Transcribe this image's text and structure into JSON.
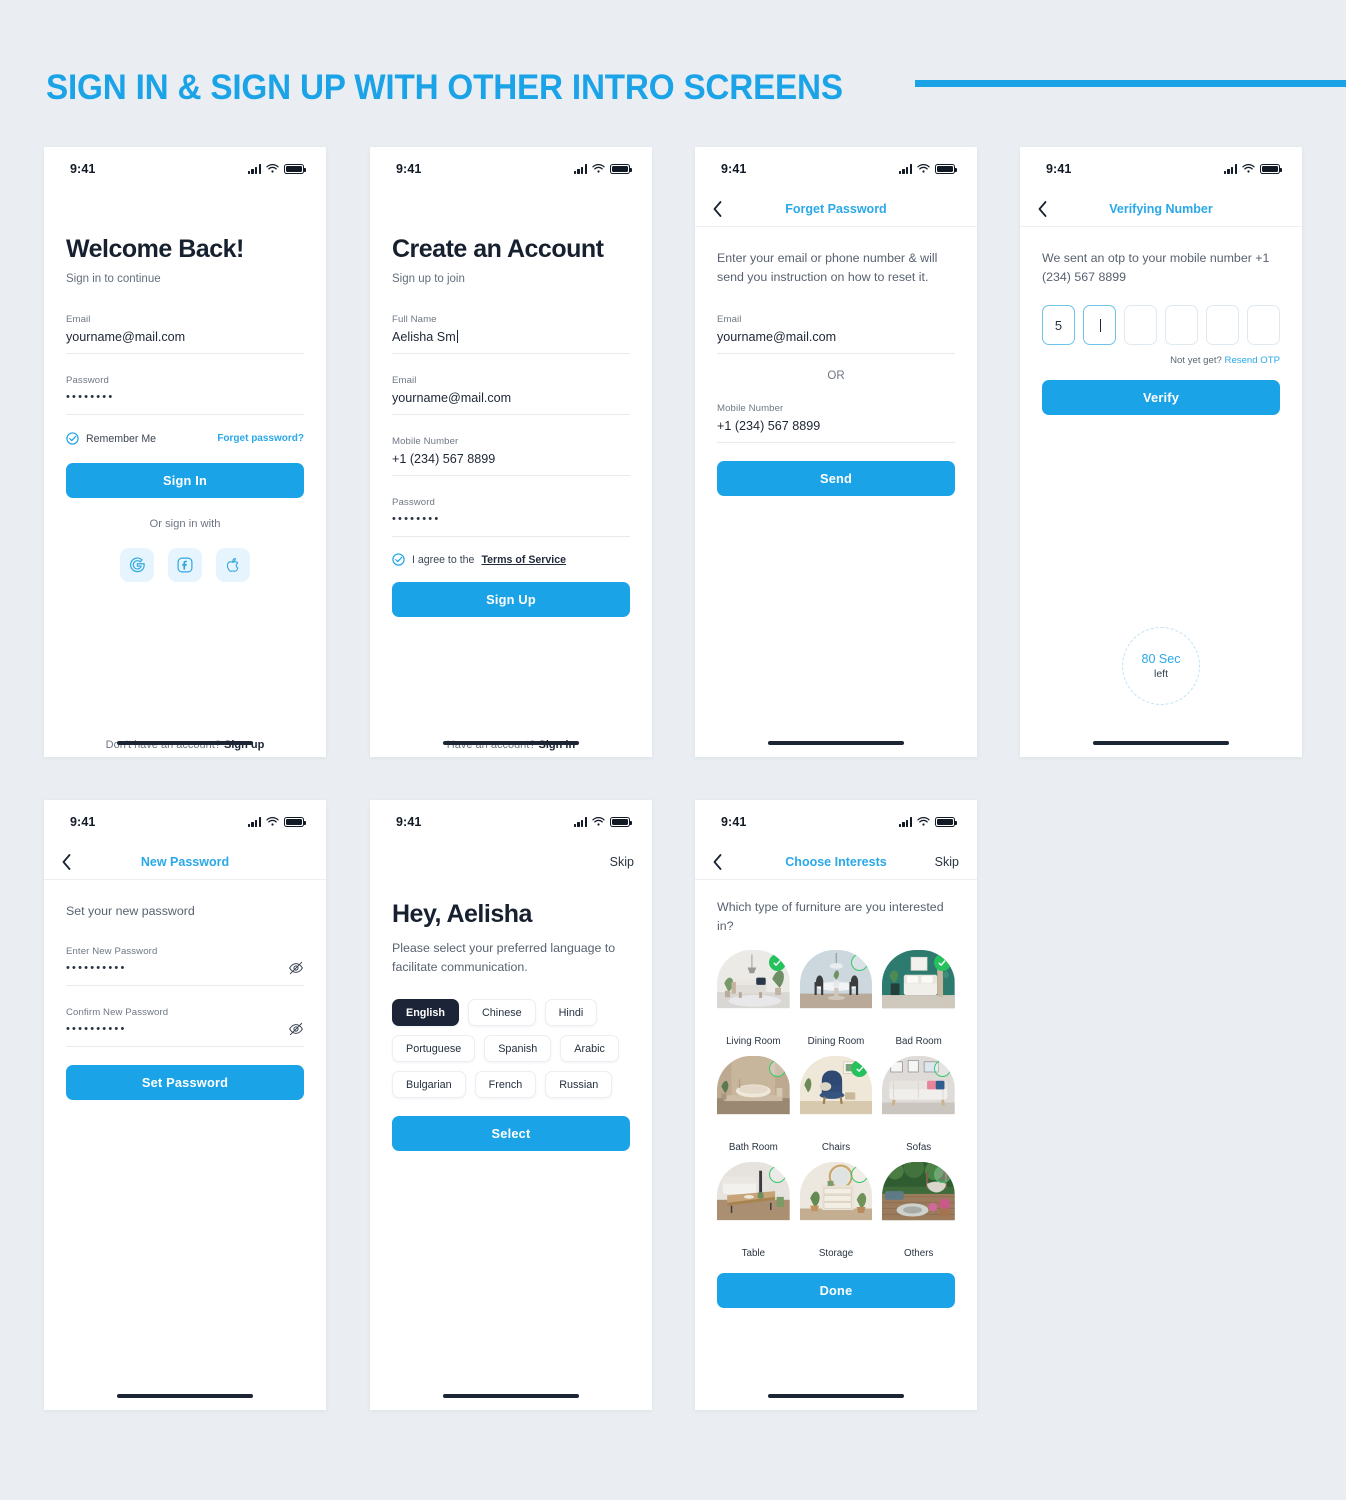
{
  "header": {
    "title": "SIGN IN & SIGN UP WITH OTHER INTRO SCREENS",
    "accent_color": "#1ba3e8"
  },
  "status_bar": {
    "time": "9:41"
  },
  "colors": {
    "primary": "#1ba3e8",
    "dark": "#1b2537",
    "green": "#25c15c",
    "page_bg": "#eaeef2"
  },
  "screens": {
    "sign_in": {
      "title": "Welcome Back!",
      "subtitle": "Sign in to continue",
      "email": {
        "label": "Email",
        "value": "yourname@mail.com"
      },
      "password": {
        "label": "Password",
        "value": "••••••••"
      },
      "remember_label": "Remember Me",
      "forget_link": "Forget password?",
      "primary_button": "Sign In",
      "or_text": "Or sign in with",
      "socials": [
        "google-icon",
        "facebook-icon",
        "apple-icon"
      ],
      "footer_text": "Don't have an account?",
      "footer_link": "Sign up"
    },
    "sign_up": {
      "title": "Create an Account",
      "subtitle": "Sign up to join",
      "full_name": {
        "label": "Full Name",
        "value": "Aelisha Sm"
      },
      "email": {
        "label": "Email",
        "value": "yourname@mail.com"
      },
      "mobile": {
        "label": "Mobile Number",
        "value": "+1 (234) 567 8899"
      },
      "password": {
        "label": "Password",
        "value": "••••••••"
      },
      "terms_prefix": "I agree to the",
      "terms_link": "Terms of Service",
      "primary_button": "Sign Up",
      "footer_text": "Have an account?",
      "footer_link": "Sign in"
    },
    "forget_password": {
      "nav_title": "Forget Password",
      "description": "Enter your email or phone number & will send you instruction on how to reset it.",
      "email": {
        "label": "Email",
        "value": "yourname@mail.com"
      },
      "or_text": "OR",
      "mobile": {
        "label": "Mobile Number",
        "value": "+1 (234) 567 8899"
      },
      "primary_button": "Send"
    },
    "verify": {
      "nav_title": "Verifying Number",
      "description": "We sent an otp to your mobile number +1 (234) 567 8899",
      "otp_digits": [
        "5",
        "",
        "",
        "",
        "",
        ""
      ],
      "otp_active_index": 1,
      "resend_prefix": "Not yet get?",
      "resend_link": "Resend OTP",
      "primary_button": "Verify",
      "timer_value": "80 Sec",
      "timer_unit": "left"
    },
    "new_password": {
      "nav_title": "New Password",
      "heading": "Set your new password",
      "enter": {
        "label": "Enter New Password",
        "value": "••••••••••"
      },
      "confirm": {
        "label": "Confirm New Password",
        "value": "••••••••••"
      },
      "primary_button": "Set Password"
    },
    "language": {
      "skip_label": "Skip",
      "title": "Hey, Aelisha",
      "description": "Please select your preferred language to facilitate communication.",
      "options": [
        {
          "label": "English",
          "selected": true
        },
        {
          "label": "Chinese",
          "selected": false
        },
        {
          "label": "Hindi",
          "selected": false
        },
        {
          "label": "Portuguese",
          "selected": false
        },
        {
          "label": "Spanish",
          "selected": false
        },
        {
          "label": "Arabic",
          "selected": false
        },
        {
          "label": "Bulgarian",
          "selected": false
        },
        {
          "label": "French",
          "selected": false
        },
        {
          "label": "Russian",
          "selected": false
        }
      ],
      "primary_button": "Select"
    },
    "interests": {
      "nav_title": "Choose Interests",
      "skip_label": "Skip",
      "question": "Which type of furniture are you interested in?",
      "items": [
        {
          "label": "Living Room",
          "selected": true
        },
        {
          "label": "Dining Room",
          "selected": false
        },
        {
          "label": "Bad Room",
          "selected": true
        },
        {
          "label": "Bath Room",
          "selected": false
        },
        {
          "label": "Chairs",
          "selected": true
        },
        {
          "label": "Sofas",
          "selected": false
        },
        {
          "label": "Table",
          "selected": false
        },
        {
          "label": "Storage",
          "selected": false
        },
        {
          "label": "Others",
          "selected": false
        }
      ],
      "primary_button": "Done"
    }
  }
}
